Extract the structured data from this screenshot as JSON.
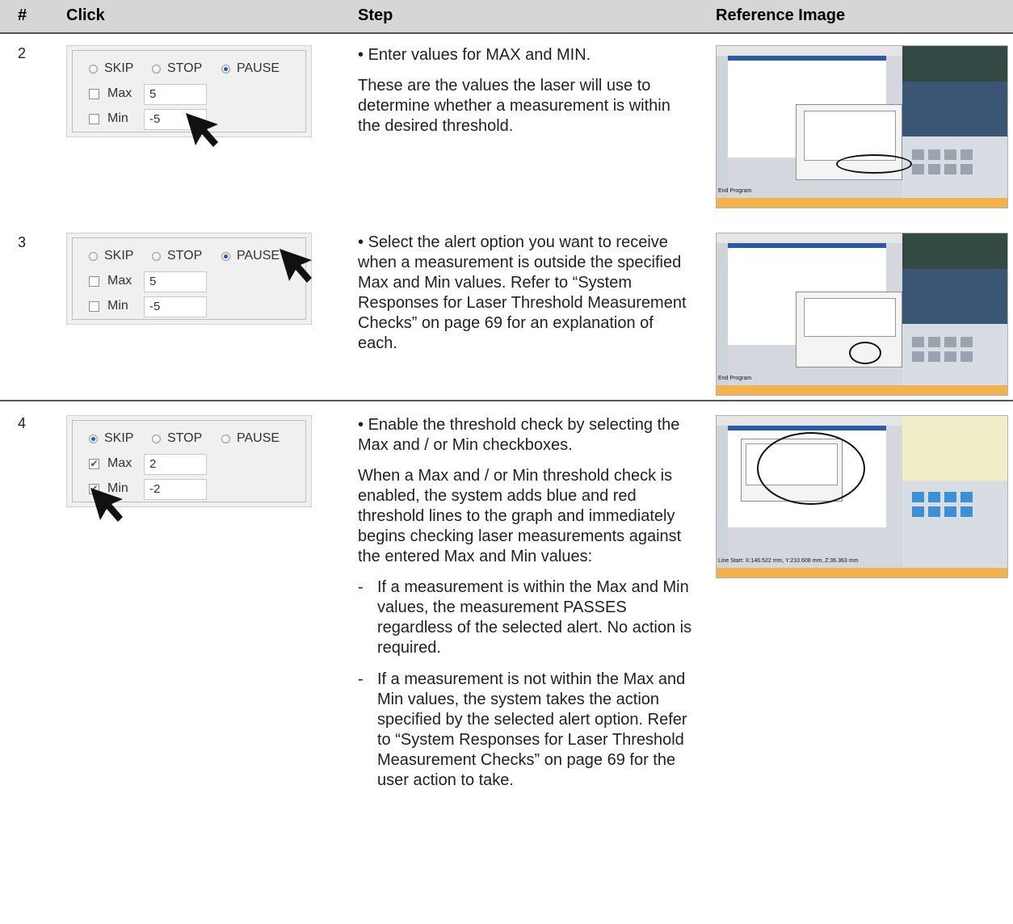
{
  "header": {
    "col_num": "#",
    "col_click": "Click",
    "col_step": "Step",
    "col_ref": "Reference Image"
  },
  "rows": [
    {
      "num": "2",
      "panel": {
        "radios": [
          {
            "label": "SKIP",
            "selected": false
          },
          {
            "label": "STOP",
            "selected": false
          },
          {
            "label": "PAUSE",
            "selected": true
          }
        ],
        "max_label": "Max",
        "max_checked": false,
        "max_value": "5",
        "min_label": "Min",
        "min_checked": false,
        "min_value": "-5"
      },
      "bullet": "Enter values for MAX and MIN.",
      "paragraph": "These are the values the laser will use to determine whether a measurement is within the desired threshold.",
      "ref_status": "End Program"
    },
    {
      "num": "3",
      "panel": {
        "radios": [
          {
            "label": "SKIP",
            "selected": false
          },
          {
            "label": "STOP",
            "selected": false
          },
          {
            "label": "PAUSE",
            "selected": true
          }
        ],
        "max_label": "Max",
        "max_checked": false,
        "max_value": "5",
        "min_label": "Min",
        "min_checked": false,
        "min_value": "-5"
      },
      "bullet": "Select the alert option you want to receive when a measurement is outside the specified Max and Min values. Refer to “System Responses for Laser Threshold Measurement Checks” on page 69 for an explanation of each.",
      "ref_status": "End Program"
    },
    {
      "num": "4",
      "panel": {
        "radios": [
          {
            "label": "SKIP",
            "selected": true
          },
          {
            "label": "STOP",
            "selected": false
          },
          {
            "label": "PAUSE",
            "selected": false
          }
        ],
        "max_label": "Max",
        "max_checked": true,
        "max_value": "2",
        "min_label": "Min",
        "min_checked": true,
        "min_value": "-2"
      },
      "bullet": "Enable the threshold check by selecting the Max and / or Min checkboxes.",
      "paragraph": "When a Max and / or Min threshold check is enabled, the system adds blue and red threshold lines to the graph and immediately begins checking laser measurements against the entered Max and Min values:",
      "subs": [
        "If a measurement is within the Max and Min values, the measurement PASSES regardless of the selected alert. No action is required.",
        "If a measurement is not within the Max and Min values, the system takes the action specified by the selected alert option. Refer to “System Responses for Laser Threshold Measurement Checks” on page 69 for the user action to take."
      ],
      "ref_status": "Line Start: X:146.522 mm, Y:210.608 mm, Z:36.363 mm"
    }
  ],
  "glyphs": {
    "bullet": "•",
    "dash": "-",
    "check": "✔"
  },
  "colors": {
    "header_bg": "#d6d6d6",
    "radio_selected": "#1e5fb3",
    "status_bar": "#f3b24b"
  }
}
